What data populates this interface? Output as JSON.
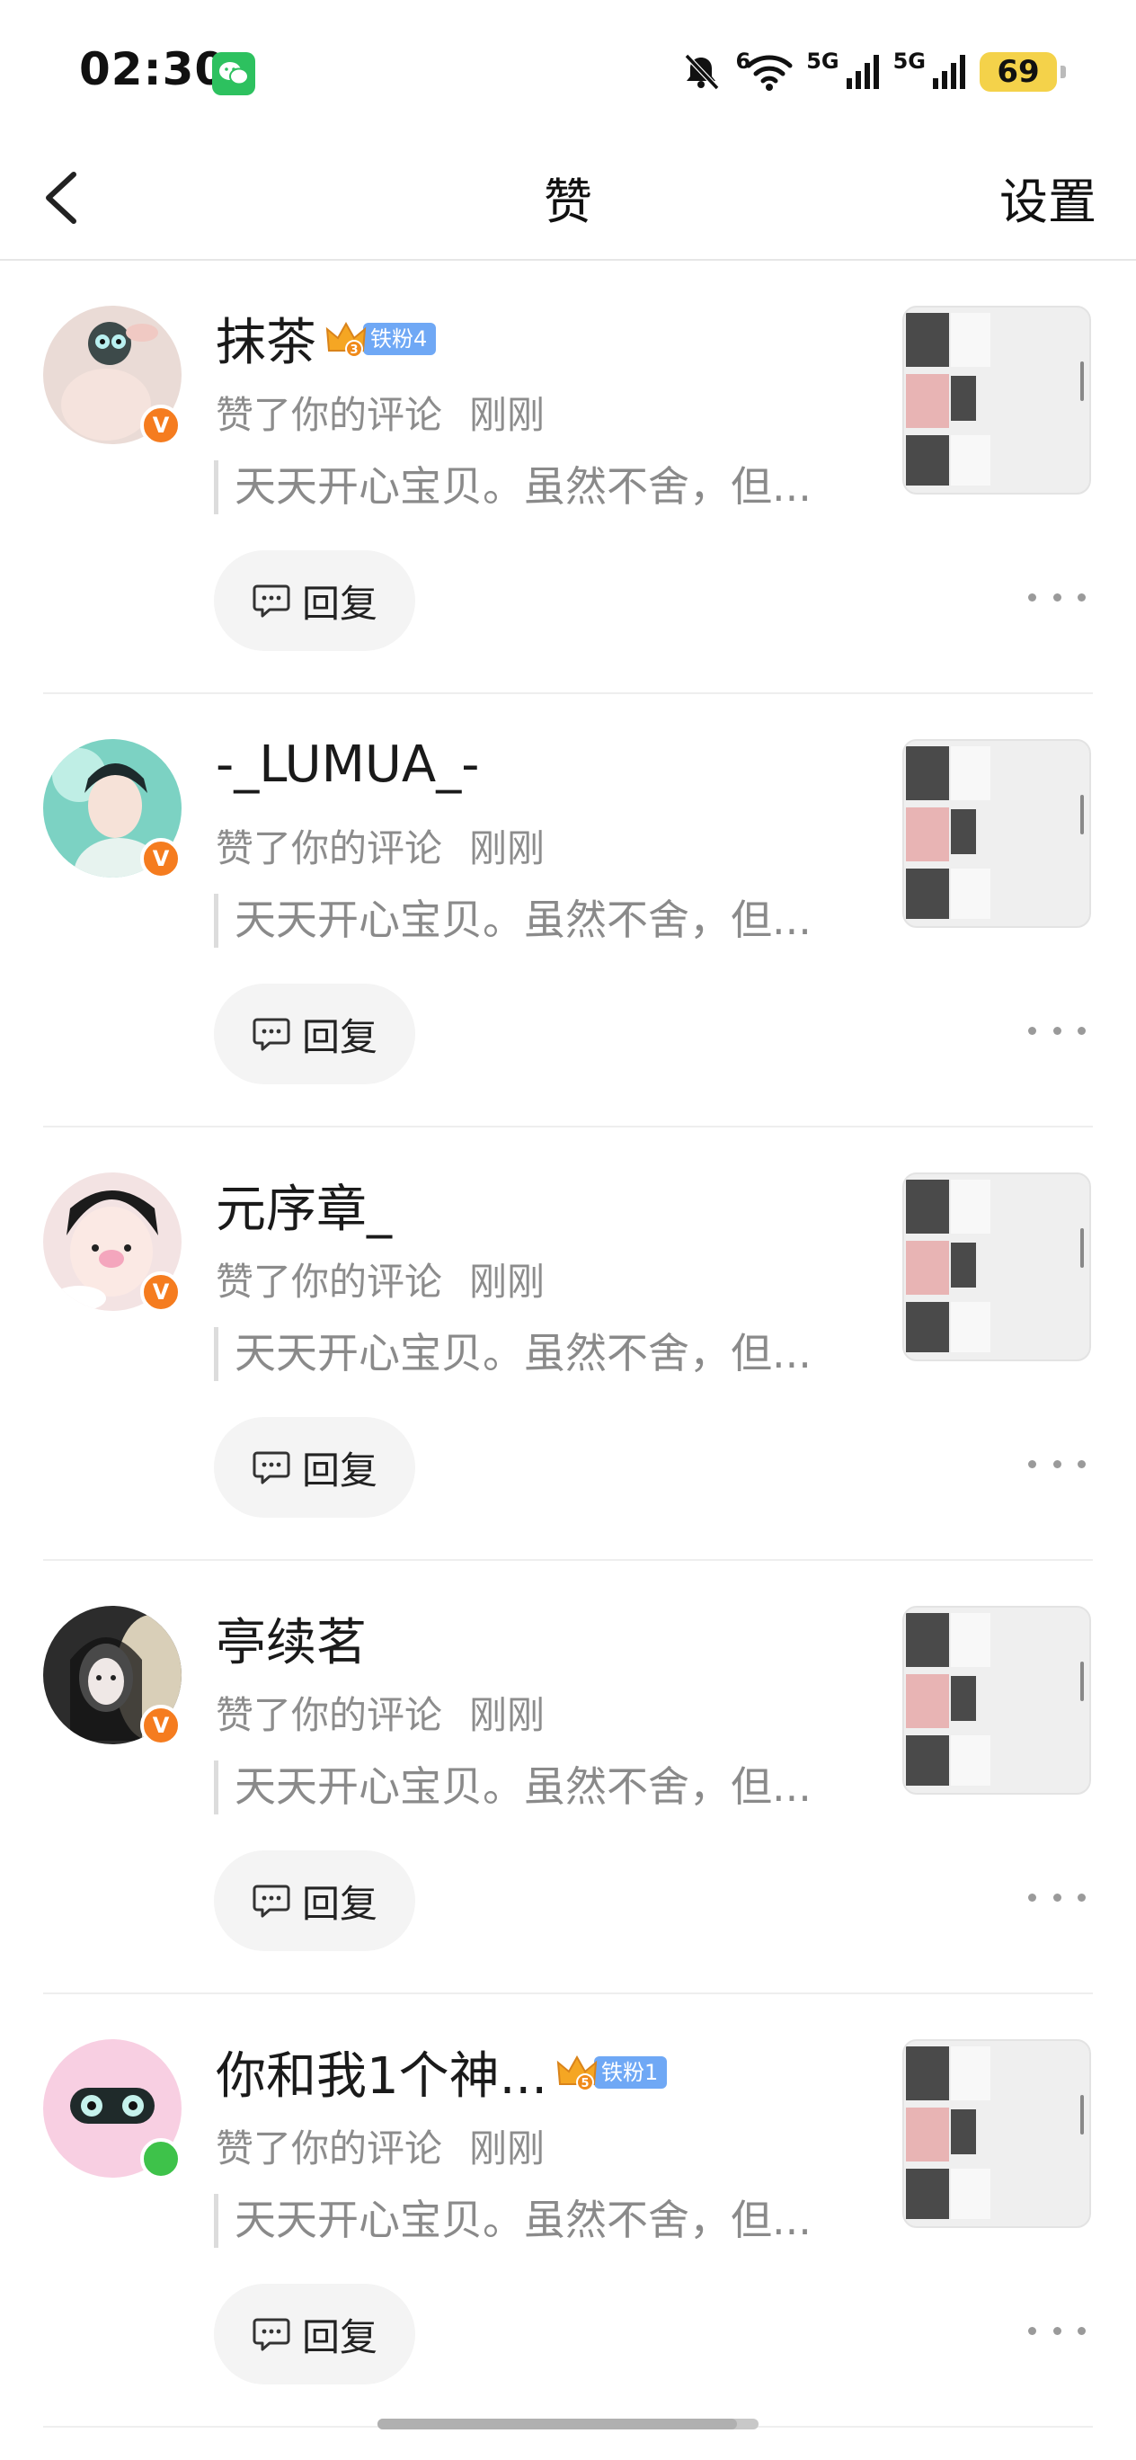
{
  "status_bar": {
    "time": "02:30",
    "signal1_label": "5G",
    "signal2_label": "5G",
    "wifi_label": "6",
    "battery": "69"
  },
  "nav": {
    "title": "赞",
    "settings": "设置"
  },
  "items": [
    {
      "name": "抹茶",
      "fan_badge": "铁粉4",
      "crown_level": "3",
      "action": "赞了你的评论",
      "time": "刚刚",
      "quote": "天天开心宝贝。虽然不舍，但...",
      "reply": "回复",
      "avatar_badge": "V",
      "avatar_color": "#e9d3cf"
    },
    {
      "name": "-_LUMUA_-",
      "fan_badge": "",
      "action": "赞了你的评论",
      "time": "刚刚",
      "quote": "天天开心宝贝。虽然不舍，但...",
      "reply": "回复",
      "avatar_badge": "V",
      "avatar_color": "#6cc7b6"
    },
    {
      "name": "元序章_",
      "fan_badge": "",
      "action": "赞了你的评论",
      "time": "刚刚",
      "quote": "天天开心宝贝。虽然不舍，但...",
      "reply": "回复",
      "avatar_badge": "V",
      "avatar_color": "#f3d8d8"
    },
    {
      "name": "亭续茗",
      "fan_badge": "",
      "action": "赞了你的评论",
      "time": "刚刚",
      "quote": "天天开心宝贝。虽然不舍，但...",
      "reply": "回复",
      "avatar_badge": "V",
      "avatar_color": "#3a3a3a"
    },
    {
      "name": "你和我1个神...",
      "fan_badge": "铁粉1",
      "crown_level": "5",
      "action": "赞了你的评论",
      "time": "刚刚",
      "quote": "天天开心宝贝。虽然不舍，但...",
      "reply": "回复",
      "avatar_badge": "",
      "avatar_color": "#f7c8de"
    }
  ],
  "colors": {
    "accent_orange": "#f57c1f",
    "online_green": "#3ec24a",
    "fan_blue": "#6fa8f5",
    "battery_yellow": "#f4d24a"
  }
}
